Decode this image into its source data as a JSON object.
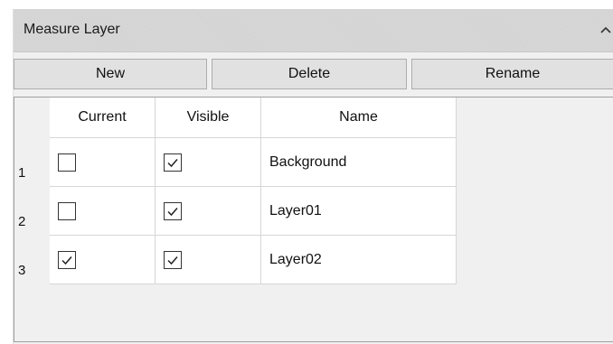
{
  "panel": {
    "title": "Measure Layer",
    "collapse_icon": "chevron-up-icon"
  },
  "toolbar": {
    "new_label": "New",
    "delete_label": "Delete",
    "rename_label": "Rename"
  },
  "table": {
    "columns": [
      "Current",
      "Visible",
      "Name"
    ],
    "rows": [
      {
        "num": "1",
        "current": false,
        "visible": true,
        "name": "Background"
      },
      {
        "num": "2",
        "current": false,
        "visible": true,
        "name": "Layer01"
      },
      {
        "num": "3",
        "current": true,
        "visible": true,
        "name": "Layer02"
      }
    ]
  },
  "colors": {
    "header_bg": "#d4d4d4",
    "button_bg": "#e1e1e1",
    "grid_line": "#d6d6d6"
  }
}
